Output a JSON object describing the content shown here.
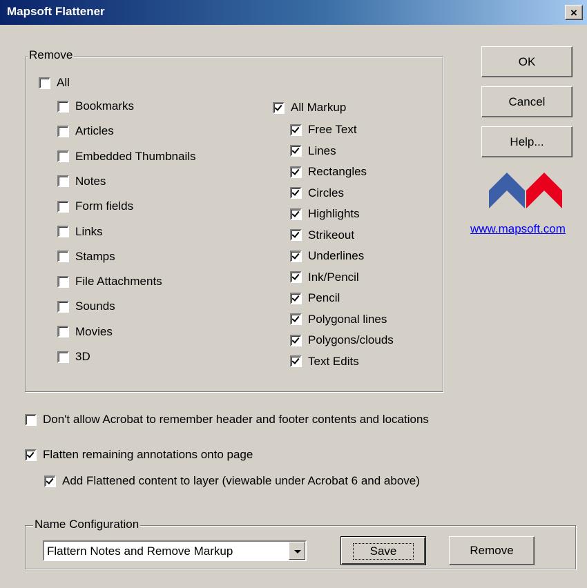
{
  "window": {
    "title": "Mapsoft Flattener",
    "close_label": "×"
  },
  "remove_group": {
    "label": "Remove",
    "all": {
      "label": "All",
      "checked": false
    },
    "left_items": [
      {
        "label": "Bookmarks",
        "checked": false
      },
      {
        "label": "Articles",
        "checked": false
      },
      {
        "label": "Embedded Thumbnails",
        "checked": false
      },
      {
        "label": "Notes",
        "checked": false
      },
      {
        "label": "Form fields",
        "checked": false
      },
      {
        "label": "Links",
        "checked": false
      },
      {
        "label": "Stamps",
        "checked": false
      },
      {
        "label": "File Attachments",
        "checked": false
      },
      {
        "label": "Sounds",
        "checked": false
      },
      {
        "label": "Movies",
        "checked": false
      },
      {
        "label": "3D",
        "checked": false
      }
    ],
    "all_markup": {
      "label": "All Markup",
      "checked": true
    },
    "markup_items": [
      {
        "label": "Free Text",
        "checked": true
      },
      {
        "label": "Lines",
        "checked": true
      },
      {
        "label": "Rectangles",
        "checked": true
      },
      {
        "label": "Circles",
        "checked": true
      },
      {
        "label": "Highlights",
        "checked": true
      },
      {
        "label": "Strikeout",
        "checked": true
      },
      {
        "label": "Underlines",
        "checked": true
      },
      {
        "label": "Ink/Pencil",
        "checked": true
      },
      {
        "label": "Pencil",
        "checked": true
      },
      {
        "label": "Polygonal lines",
        "checked": true
      },
      {
        "label": "Polygons/clouds",
        "checked": true
      },
      {
        "label": "Text Edits",
        "checked": true
      }
    ]
  },
  "buttons": {
    "ok": "OK",
    "cancel": "Cancel",
    "help": "Help..."
  },
  "logo": {
    "icon": "mapsoft-logo-icon",
    "blue": "#3d5fa8",
    "red": "#e8001c"
  },
  "website": "www.mapsoft.com",
  "options": {
    "header_footer": {
      "label": "Don't allow Acrobat to remember header and footer contents and locations",
      "checked": false
    },
    "flatten": {
      "label": "Flatten remaining annotations onto page",
      "checked": true
    },
    "layer": {
      "label": "Add Flattened content to layer (viewable under Acrobat 6 and above)",
      "checked": true
    }
  },
  "name_config": {
    "label": "Name Configuration",
    "selected": "Flattern Notes and Remove Markup",
    "save_label": "Save",
    "remove_label": "Remove"
  }
}
